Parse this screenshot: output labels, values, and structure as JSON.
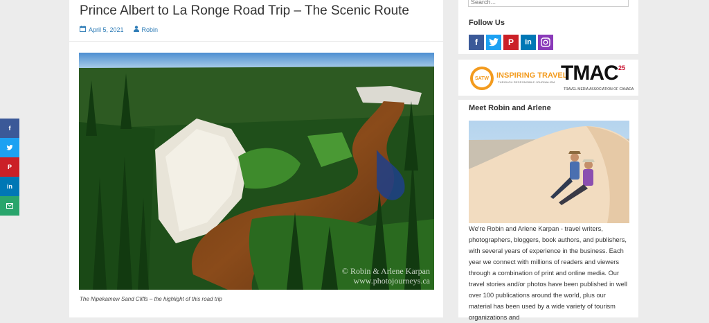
{
  "post": {
    "title": "Prince Albert to La Ronge Road Trip – The Scenic Route",
    "date": "April 5, 2021",
    "author": "Robin",
    "image_watermark_line1": "© Robin & Arlene Karpan",
    "image_watermark_line2": "www.photojourneys.ca",
    "caption": "The Nipekamew Sand Cliffs – the highlight of this road trip"
  },
  "sidebar": {
    "search_placeholder": "Search...",
    "follow_title": "Follow Us",
    "social_icons": [
      "facebook-icon",
      "twitter-icon",
      "pinterest-icon",
      "linkedin-icon",
      "instagram-icon"
    ],
    "satw_line1": "INSPIRING TRAVEL",
    "satw_line2": "THROUGH RESPONSIBLE JOURNALISM",
    "satw_badge": "SATW",
    "tmac": "TMAC",
    "tmac_sub": "TRAVEL MEDIA ASSOCIATION OF CANADA",
    "tmac_25": "25",
    "meet_title": "Meet Robin and Arlene",
    "bio": "We're Robin and Arlene Karpan - travel writers, photographers, bloggers, book authors, and publishers, with several years of experience in the business. Each year we connect with millions of readers and viewers through a combination of print and online media. Our travel stories and/or photos have been published in well over 100 publications around the world, plus our material has been used by a wide variety of tourism organizations and"
  },
  "floating_share": [
    "facebook-icon",
    "twitter-icon",
    "pinterest-icon",
    "linkedin-icon",
    "email-icon"
  ],
  "colors": {
    "link": "#2c7bb6",
    "facebook": "#3b5998",
    "twitter": "#1da1f2",
    "pinterest": "#cb2027",
    "linkedin": "#0077b5",
    "email": "#29a56c",
    "instagram": "#8a3ab9"
  }
}
